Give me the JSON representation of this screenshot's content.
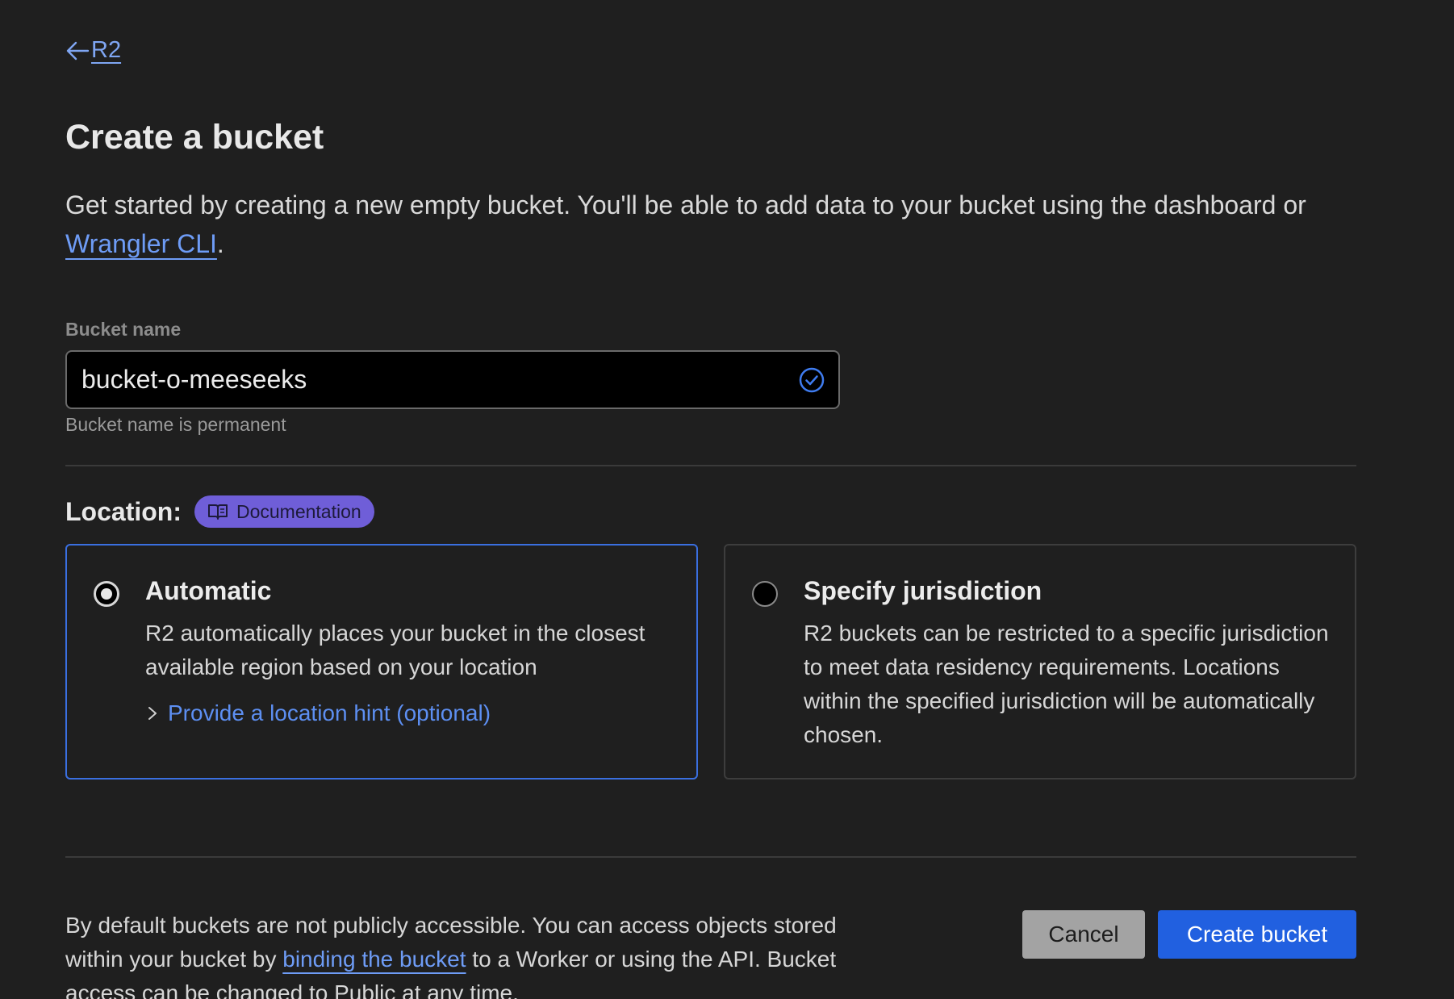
{
  "nav": {
    "back_label": "R2"
  },
  "header": {
    "title": "Create a bucket"
  },
  "intro": {
    "text": "Get started by creating a new empty bucket. You'll be able to add data to your bucket using the dashboard or ",
    "link": "Wrangler CLI",
    "suffix": "."
  },
  "bucket_name": {
    "label": "Bucket name",
    "value": "bucket-o-meeseeks",
    "helper": "Bucket name is permanent",
    "status_icon": "check-circle-icon"
  },
  "location": {
    "label": "Location:",
    "doc_badge": "Documentation",
    "options": [
      {
        "title": "Automatic",
        "description": "R2 automatically places your bucket in the closest available region based on your location",
        "hint": "Provide a location hint (optional)",
        "selected": true
      },
      {
        "title": "Specify jurisdiction",
        "description": "R2 buckets can be restricted to a specific jurisdiction to meet data residency requirements. Locations within the specified jurisdiction will be automatically chosen.",
        "selected": false
      }
    ]
  },
  "footer": {
    "text_before": "By default buckets are not publicly accessible. You can access objects stored within your bucket by ",
    "link": "binding the bucket",
    "text_after": " to a Worker or using the API. Bucket access can be changed to Public at any time.",
    "cancel_label": "Cancel",
    "create_label": "Create bucket"
  },
  "colors": {
    "background": "#1f1f1f",
    "accent": "#2160e0",
    "link": "#6e9cf6",
    "badge": "#6f5ed8"
  }
}
